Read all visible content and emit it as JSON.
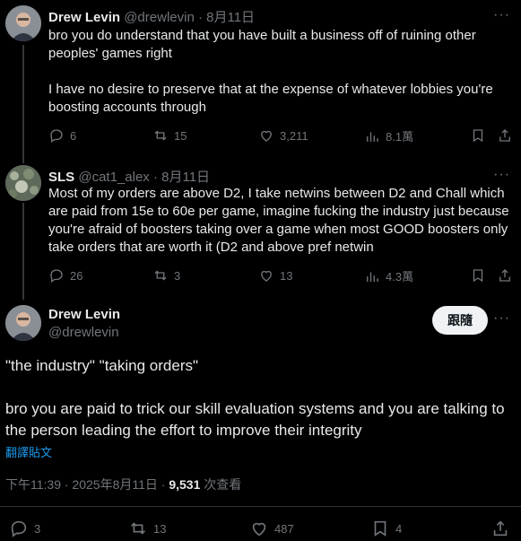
{
  "tweets": [
    {
      "name": "Drew Levin",
      "handle": "@drewlevin",
      "date": "· 8月11日",
      "text_p1": "bro you do understand that you have built a business off of ruining other peoples' games right",
      "text_p2": "I have no desire to preserve that at the expense of whatever lobbies you're boosting accounts through",
      "replies": "6",
      "retweets": "15",
      "likes": "3,211",
      "views": "8.1萬"
    },
    {
      "name": "SLS",
      "handle": "@cat1_alex",
      "date": "· 8月11日",
      "text_p1": "Most of my orders are above D2, I take netwins between D2 and Chall which are paid from 15e to 60e per game, imagine fucking the industry just because you're afraid of boosters taking over a game when most GOOD boosters only take orders that are worth it (D2 and above pref netwin",
      "replies": "26",
      "retweets": "3",
      "likes": "13",
      "views": "4.3萬"
    }
  ],
  "main_tweet": {
    "name": "Drew Levin",
    "handle": "@drewlevin",
    "follow_label": "跟隨",
    "text_p1": "\"the industry\" \"taking orders\"",
    "text_p2": "bro you are paid to trick our skill evaluation systems and you are talking to the person leading the effort to improve their integrity",
    "translate_label": "翻譯貼文",
    "timestamp": "下午11:39 · 2025年8月11日 · ",
    "views_count": "9,531",
    "views_label": " 次查看",
    "replies": "3",
    "retweets": "13",
    "likes": "487",
    "bookmarks": "4"
  },
  "more_label": "···"
}
